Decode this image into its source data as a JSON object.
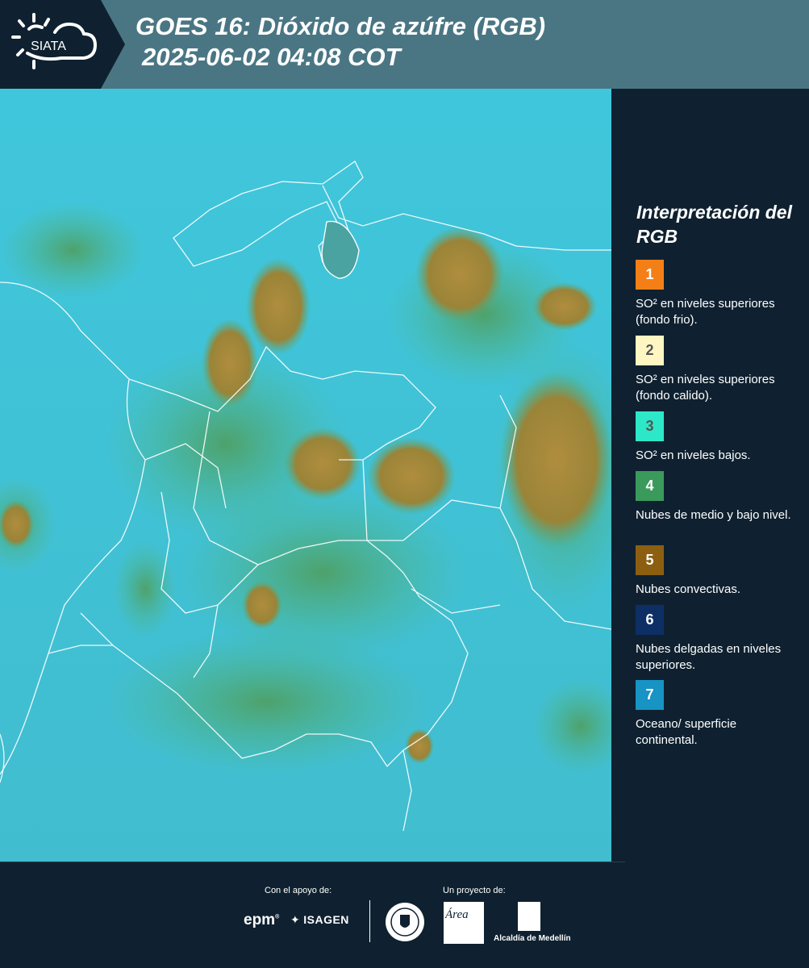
{
  "header": {
    "brand": "SIATA",
    "title_line1": "GOES 16: Dióxido de azúfre (RGB)",
    "title_line2": "2025-06-02 04:08 COT"
  },
  "legend": {
    "title": "Interpretación del RGB",
    "items": [
      {
        "number": "1",
        "text": "SO² en niveles superiores (fondo frio).",
        "color": "#f57f17",
        "number_color": "#ffffff"
      },
      {
        "number": "2",
        "text": "SO² en niveles superiores (fondo calido).",
        "color": "#fff6c2",
        "number_color": "#555555"
      },
      {
        "number": "3",
        "text": "SO² en niveles bajos.",
        "color": "#2de8c8",
        "number_color": "#555555"
      },
      {
        "number": "4",
        "text": "Nubes de medio y bajo nivel.",
        "color": "#3a9a5c",
        "number_color": "#ffffff"
      },
      {
        "number": "5",
        "text": "Nubes convectivas.",
        "color": "#8c5f10",
        "number_color": "#ffffff"
      },
      {
        "number": "6",
        "text": "Nubes delgadas en niveles superiores.",
        "color": "#0d2f66",
        "number_color": "#ffffff"
      },
      {
        "number": "7",
        "text": "Oceano/ superficie continental.",
        "color": "#1793c4",
        "number_color": "#ffffff"
      }
    ]
  },
  "footer": {
    "support_label": "Con el apoyo de:",
    "project_label": "Un proyecto de:",
    "epm": "epm",
    "isagen": "ISAGEN",
    "area_metropolitana": "Área",
    "alcaldia": "Alcaldía de Medellín"
  },
  "colors": {
    "background": "#0f2130",
    "header": "#4a7684",
    "ocean": "#3fc9de",
    "convective": "#a9893f",
    "low_cloud": "#4fa36c"
  }
}
